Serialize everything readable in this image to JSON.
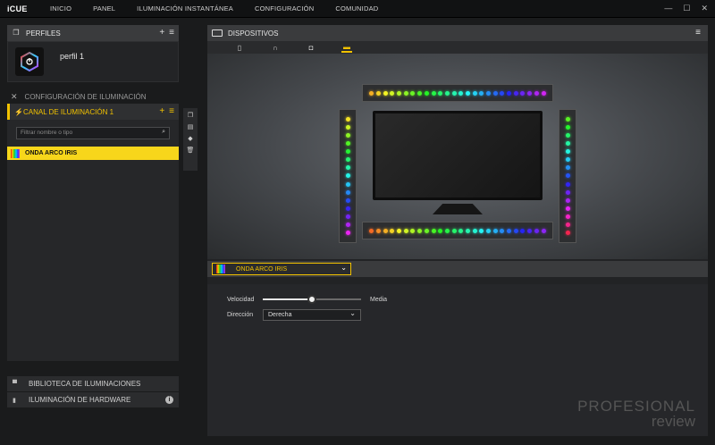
{
  "app": {
    "logo": "iCUE"
  },
  "nav": [
    "INICIO",
    "PANEL",
    "ILUMINACIÓN INSTANTÁNEA",
    "CONFIGURACIÓN",
    "COMUNIDAD"
  ],
  "window_controls": {
    "minimize": "—",
    "maximize": "☐",
    "close": "✕"
  },
  "profiles": {
    "title": "PERFILES",
    "add": "+",
    "menu": "≡",
    "items": [
      {
        "name": "perfil 1"
      }
    ]
  },
  "lighting_config": {
    "title": "CONFIGURACIÓN DE ILUMINACIÓN"
  },
  "channel": {
    "title": "CANAL DE ILUMINACIÓN 1",
    "add": "+",
    "menu": "≡",
    "filter_placeholder": "Filtrar nombre o tipo",
    "effects": [
      "ONDA ARCO IRIS"
    ]
  },
  "bottom": {
    "library": "BIBLIOTECA DE ILUMINACIONES",
    "hardware": "ILUMINACIÓN DE HARDWARE",
    "info": "i"
  },
  "devices": {
    "title": "DISPOSITIVOS",
    "tabs": [
      "mouse-icon",
      "headset-icon",
      "device-hub-icon",
      "led-strip-icon"
    ],
    "active_tab": 3
  },
  "effect": {
    "selected": "ONDA ARCO IRIS"
  },
  "settings": {
    "speed_label": "Velocidad",
    "speed_value_label": "Media",
    "speed_level": 0.5,
    "direction_label": "Dirección",
    "direction_value": "Derecha"
  },
  "colors": {
    "accent": "#f2c200"
  },
  "watermark": {
    "line1": "PROFESIONAL",
    "line2": "review"
  }
}
